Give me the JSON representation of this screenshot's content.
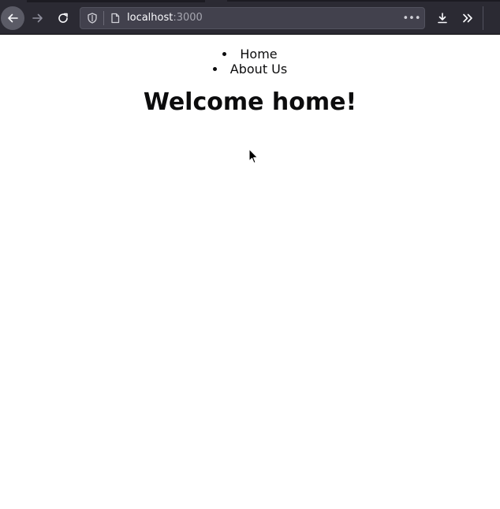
{
  "browser": {
    "url_host": "localhost",
    "url_port": ":3000",
    "more_glyph": "•••",
    "icons": {
      "back": "back-arrow-icon",
      "forward": "forward-arrow-icon",
      "reload": "reload-icon",
      "shield": "tracking-shield-icon",
      "page": "page-icon",
      "download": "download-icon",
      "overflow": "chevron-double-right-icon"
    }
  },
  "nav": {
    "items": [
      {
        "label": "Home"
      },
      {
        "label": "About Us"
      }
    ]
  },
  "main": {
    "heading": "Welcome home!"
  },
  "colors": {
    "chrome_bg": "#2b2a33",
    "urlbar_bg": "#42414d",
    "page_bg": "#ffffff",
    "text": "#0c0c0d"
  }
}
